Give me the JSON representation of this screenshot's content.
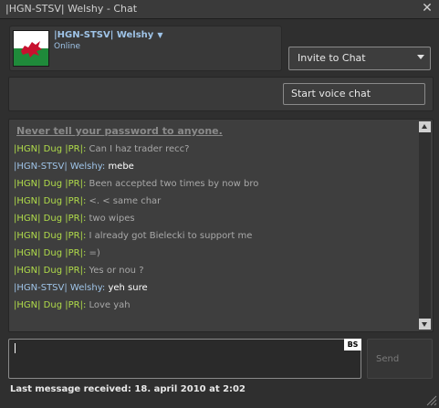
{
  "window": {
    "title": "|HGN-STSV| Welshy - Chat"
  },
  "friend": {
    "name": "|HGN-STSV| Welshy",
    "status": "Online"
  },
  "invite": {
    "label": "Invite to Chat"
  },
  "voice": {
    "label": "Start voice chat"
  },
  "chat": {
    "warning": "Never tell your password to anyone.",
    "messages": [
      {
        "sender": "|HGN| Dug |PR|: ",
        "text": "Can I haz trader recc?",
        "self": false
      },
      {
        "sender": "|HGN-STSV| Welshy: ",
        "text": "mebe",
        "self": true
      },
      {
        "sender": "|HGN| Dug |PR|: ",
        "text": "Been accepted two times by now bro",
        "self": false
      },
      {
        "sender": "|HGN| Dug |PR|: ",
        "text": "<. < same char",
        "self": false
      },
      {
        "sender": "|HGN| Dug |PR|: ",
        "text": "two wipes",
        "self": false
      },
      {
        "sender": "|HGN| Dug |PR|: ",
        "text": "I already got Bielecki to support me",
        "self": false
      },
      {
        "sender": "|HGN| Dug |PR|: ",
        "text": "=)",
        "self": false
      },
      {
        "sender": "|HGN| Dug |PR|: ",
        "text": "Yes or nou ?",
        "self": false
      },
      {
        "sender": "|HGN-STSV| Welshy: ",
        "text": "yeh sure",
        "self": true
      },
      {
        "sender": "|HGN| Dug |PR|: ",
        "text": "Love yah",
        "self": false
      }
    ]
  },
  "composer": {
    "value": "",
    "badge": "BS"
  },
  "send": {
    "label": "Send"
  },
  "footer": {
    "last_message": "Last message received: 18. april 2010 at 2:02"
  },
  "colors": {
    "other_sender": "#b0dc4a",
    "self_sender": "#9fc4e8",
    "other_text": "#a8a8a8",
    "self_text": "#ffffff"
  },
  "icons": {
    "close": "close-icon",
    "dropdown": "chevron-down-icon",
    "avatar": "wales-flag-avatar"
  }
}
